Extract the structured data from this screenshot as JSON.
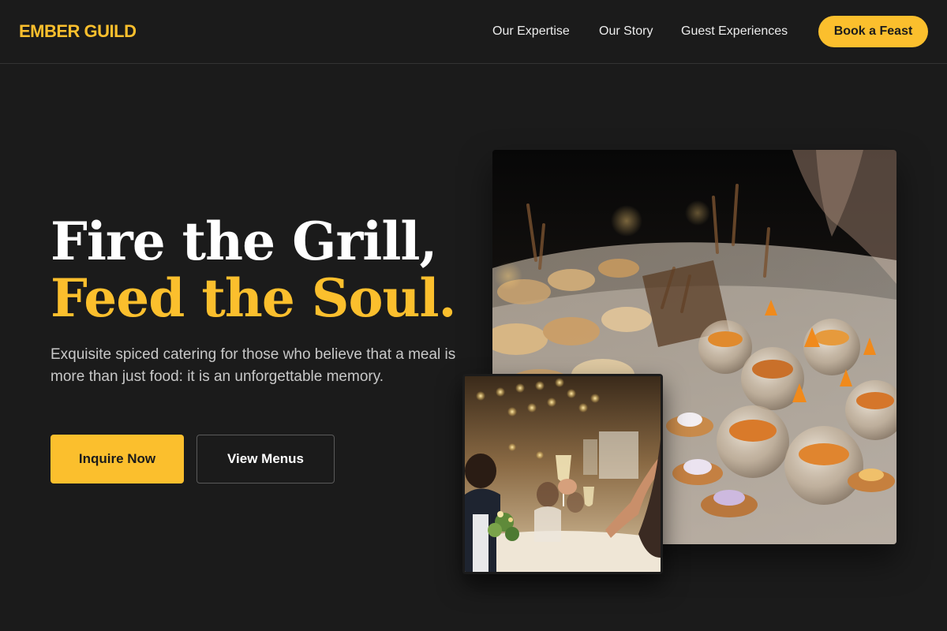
{
  "brand": {
    "name": "EMBER GUILD",
    "accent": "#fbbf2d",
    "background": "#1b1b1b"
  },
  "nav": {
    "links": [
      "Our Expertise",
      "Our Story",
      "Guest Experiences"
    ],
    "cta_label": "Book a Feast"
  },
  "hero": {
    "headline_line1": "Fire the Grill,",
    "headline_line2": "Feed the Soul.",
    "subcopy": "Exquisite spiced catering for those who believe that a meal is more than just food: it is an unforgettable memory.",
    "primary_button": "Inquire Now",
    "secondary_button": "View Menus"
  },
  "images": {
    "main": {
      "alt": "Catering buffet with desserts in glasses and tartlets"
    },
    "inset": {
      "alt": "Guests raising a champagne toast at a festive dinner"
    }
  }
}
